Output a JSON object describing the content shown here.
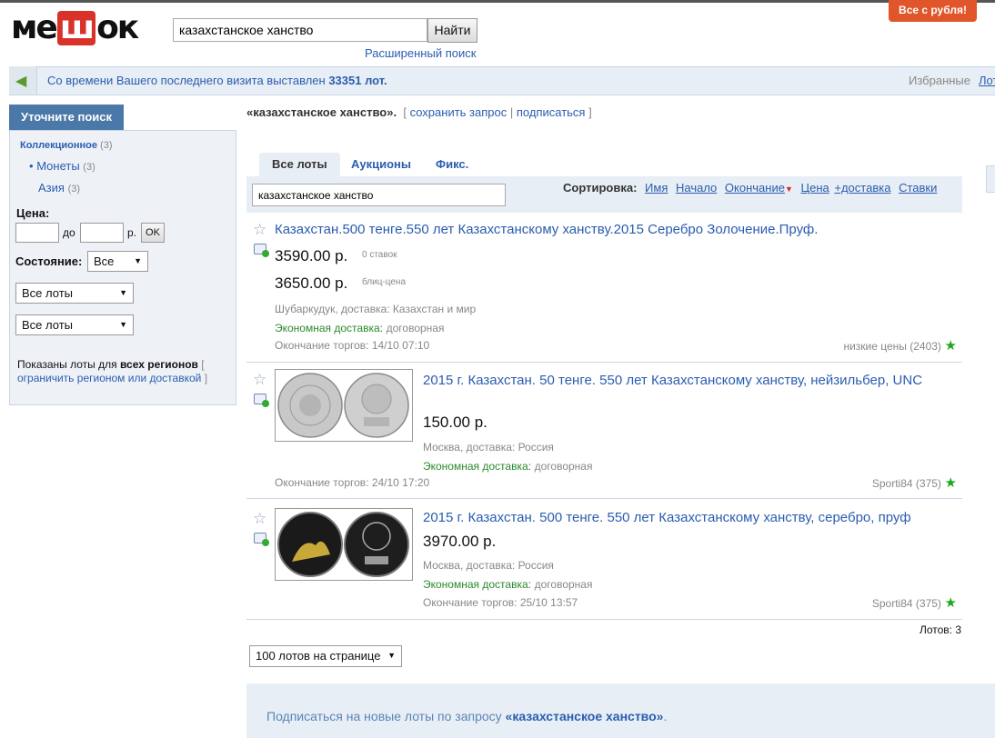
{
  "header": {
    "logo_left": "ме",
    "logo_bag": "ш",
    "logo_right": "ок",
    "search_value": "казахстанское ханство",
    "search_button": "Найти",
    "advanced_search": "Расширенный поиск",
    "promo": "Все с рубля!"
  },
  "infobar": {
    "text_prefix": "Со времени Вашего последнего визита выставлен",
    "lot_count": "33351 лот.",
    "favorites": "Избранные",
    "fav_link": "Лот"
  },
  "sidebar": {
    "title": "Уточните поиск",
    "category": "Коллекционное",
    "category_count": "(3)",
    "subcategory": "Монеты",
    "subcategory_count": "(3)",
    "subsub": "Азия",
    "subsub_count": "(3)",
    "price_label": "Цена:",
    "price_to": "до",
    "price_currency": "р.",
    "ok": "OK",
    "state_label": "Состояние:",
    "state_value": "Все",
    "filter1": "Все лоты",
    "filter2": "Все лоты",
    "regions_text_1": "Показаны лоты для",
    "regions_bold_1": "всех",
    "regions_bold_2": "регионов",
    "regions_link": "ограничить регионом или доставкой"
  },
  "main": {
    "query": "«казахстанское ханство».",
    "save_query": "сохранить запрос",
    "subscribe": "подписаться",
    "tabs": [
      "Все лоты",
      "Аукционы",
      "Фикс."
    ],
    "filter_value": "казахстанское ханство",
    "sort_label": "Сортировка:",
    "sort_options": [
      "Имя",
      "Начало",
      "Окончание",
      "Цена",
      "+доставка",
      "Ставки"
    ],
    "lots_total": "Лотов: 3",
    "per_page": "100 лотов на странице",
    "subscribe_line_prefix": "Подписаться на новые лоты по запросу",
    "subscribe_line_query": "«казахстанское ханство»",
    "subscribe_line_suffix": "."
  },
  "lots": [
    {
      "title": "Казахстан.500 тенге.550 лет Казахстанскому ханству.2015 Серебро Золочение.Пруф.",
      "price": "3590.00 р.",
      "price_note": "0 ставок",
      "price2": "3650.00 р.",
      "price2_note": "блиц-цена",
      "location": "Шубаркудук, доставка: Казахстан и мир",
      "delivery_label": "Экономная доставка:",
      "delivery_value": "договорная",
      "end": "Окончание торгов: 14/10 07:10",
      "seller": "низкие цены (2403)"
    },
    {
      "title": "2015 г. Казахстан. 50 тенге. 550 лет Казахстанскому ханству, нейзильбер, UNC",
      "price": "150.00 р.",
      "location": "Москва, доставка: Россия",
      "delivery_label": "Экономная доставка:",
      "delivery_value": "договорная",
      "end": "Окончание торгов: 24/10 17:20",
      "seller": "Sporti84 (375)"
    },
    {
      "title": "2015 г. Казахстан. 500 тенге. 550 лет Казахстанскому ханству, серебро, пруф",
      "price": "3970.00 р.",
      "location": "Москва, доставка: Россия",
      "delivery_label": "Экономная доставка:",
      "delivery_value": "договорная",
      "end": "Окончание торгов: 25/10 13:57",
      "seller": "Sporti84 (375)"
    }
  ],
  "colors": {
    "link": "#2a5db0",
    "green": "#2a8a2a",
    "promo": "#e0562a",
    "sidebar_head": "#4a78a8"
  }
}
